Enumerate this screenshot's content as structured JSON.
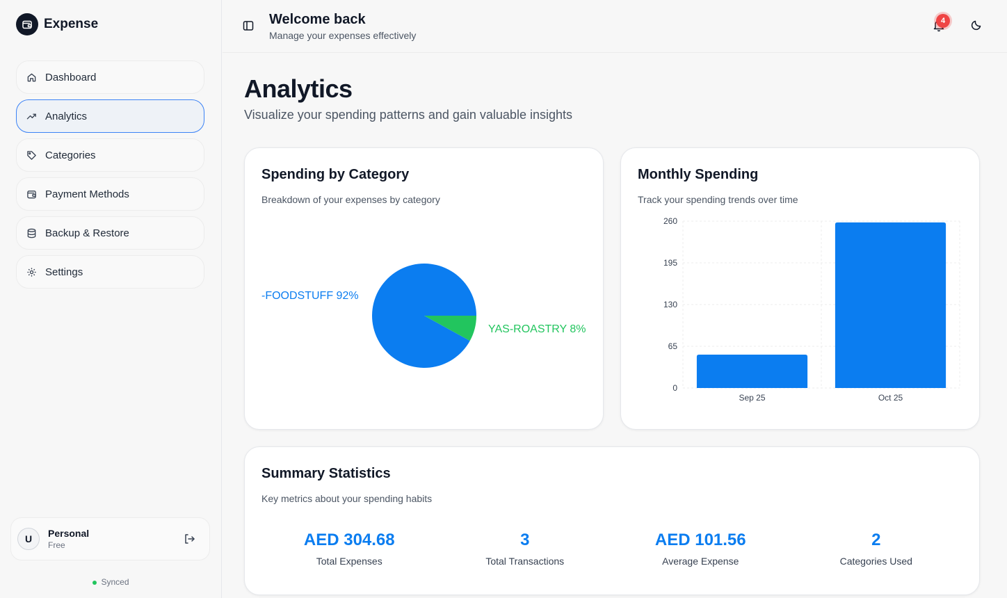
{
  "brand": {
    "name": "Expense"
  },
  "nav": [
    {
      "label": "Dashboard",
      "icon": "home-icon"
    },
    {
      "label": "Analytics",
      "icon": "trending-up-icon",
      "active": true
    },
    {
      "label": "Categories",
      "icon": "tag-icon"
    },
    {
      "label": "Payment Methods",
      "icon": "wallet-icon"
    },
    {
      "label": "Backup & Restore",
      "icon": "database-icon"
    },
    {
      "label": "Settings",
      "icon": "gear-icon"
    }
  ],
  "account": {
    "initial": "U",
    "name": "Personal",
    "plan": "Free"
  },
  "sync": {
    "status": "Synced"
  },
  "header": {
    "title": "Welcome back",
    "subtitle": "Manage your expenses effectively",
    "notification_count": "4"
  },
  "page": {
    "title": "Analytics",
    "subtitle": "Visualize your spending patterns and gain valuable insights"
  },
  "spending_card": {
    "title": "Spending by Category",
    "subtitle": "Breakdown of your expenses by category"
  },
  "monthly_card": {
    "title": "Monthly Spending",
    "subtitle": "Track your spending trends over time"
  },
  "summary": {
    "title": "Summary Statistics",
    "subtitle": "Key metrics about your spending habits",
    "stats": [
      {
        "value": "AED 304.68",
        "label": "Total Expenses"
      },
      {
        "value": "3",
        "label": "Total Transactions"
      },
      {
        "value": "AED 101.56",
        "label": "Average Expense"
      },
      {
        "value": "2",
        "label": "Categories Used"
      }
    ]
  },
  "colors": {
    "accent": "#0b7df0",
    "green": "#22c55e",
    "badge": "#ef4444"
  },
  "chart_data": [
    {
      "type": "pie",
      "slices": [
        {
          "label": "-FOODSTUFF 92%",
          "value": 92,
          "color": "#0b7df0"
        },
        {
          "label": "YAS-ROASTRY 8%",
          "value": 8,
          "color": "#22c55e"
        }
      ]
    },
    {
      "type": "bar",
      "categories": [
        "Sep 25",
        "Oct 25"
      ],
      "values": [
        52,
        258
      ],
      "yticks": [
        "0",
        "65",
        "130",
        "195",
        "260"
      ],
      "ylim": [
        0,
        260
      ],
      "grid": true,
      "color": "#0b7df0"
    }
  ]
}
